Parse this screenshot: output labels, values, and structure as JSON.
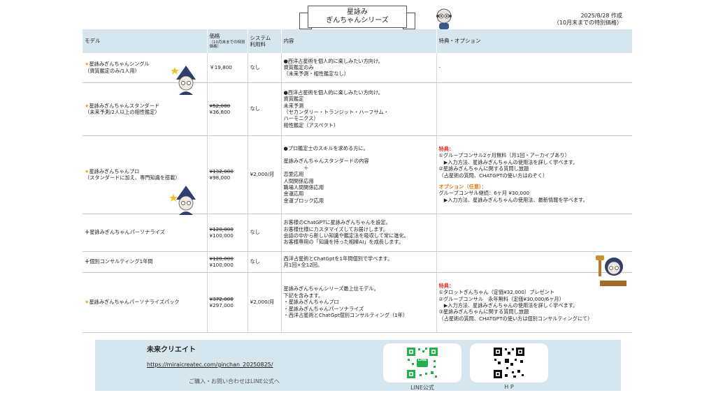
{
  "header": {
    "title_line1": "星詠み",
    "title_line2": "ぎんちゃんシリーズ",
    "date": "2025/8/28 作成",
    "date_note": "（10月末までの特別価格）"
  },
  "table": {
    "columns": {
      "model": "モデル",
      "price": "価格",
      "price_note": "（10月末までの特別価格）",
      "system_line1": "システム",
      "system_line2": "利用料",
      "content": "内容",
      "benefits": "特典・オプション"
    },
    "rows": [
      {
        "name": "星詠みぎんちゃんシングル",
        "sub": "（資質鑑定のみ/1人用）",
        "price_now": "￥19,800",
        "fee": "なし",
        "content": [
          "●西洋占星術を個人的に楽しみたい方向け。",
          "資質鑑定のみ",
          "（未来予測・相性鑑定なし）"
        ],
        "benefits": [
          "-"
        ]
      },
      {
        "name": "星詠みぎんちゃんスタンダード",
        "sub": "（未来予測/2人以上の相性鑑定）",
        "price_old": "¥52,000",
        "price_now": "¥36,800",
        "fee": "なし",
        "content": [
          "●西洋占星術を個人的に楽しみたい方向け。",
          "資質鑑定",
          "未来予測",
          "（セカンダリー・トランジット・ハーフサム・",
          "ハーモニクス）",
          "相性鑑定（アスペクト）"
        ],
        "benefits": []
      },
      {
        "name": "星詠みぎんちゃんプロ",
        "sub": "（スタンダードに加え、専門知識を搭載）",
        "price_old": "¥132,000",
        "price_now": "¥98,000",
        "fee": "¥2,000/月",
        "content": [
          "●プロ鑑定士のスキルを求める方に。",
          "",
          "星詠みぎんちゃんスタンダードの内容",
          "　　　　＋",
          "恋愛応用",
          "人間関係応用",
          "職場人間関係応用",
          "金運応用",
          "金運ブロック応用"
        ],
        "benefits_label": "特典：",
        "benefits": [
          "①グループコンサル2ヶ月無料（月1回・アーカイブあり）",
          "　▶入力方法、星詠みぎんちゃんの使用法を詳しく学べます。",
          "②星詠みぎんちゃんに関する質問し放題",
          "（占星術の質問、CHATGPTの使い方はのぞく）"
        ],
        "option_label": "オプション（任意）：",
        "options": [
          "グループコンサル継続：6ヶ月 ¥30,000",
          "　▶入力方法、星詠みぎんちゃんの使用法、最新情報を学べます。"
        ]
      },
      {
        "name": "星詠みぎんちゃんパーソナライズ",
        "price_old": "¥120,000",
        "price_now": "¥100,000",
        "fee": "なし",
        "content": [
          "お客様のChatGPTに星詠みぎんちゃんを設定。",
          "お客様仕様にカスタマイズしてお届けします。",
          "会話の中から新しい知識や鑑定法を吸収して常に進化。",
          "お客様専用の「知識を持った相棒AI」を成長します。"
        ],
        "benefits": []
      },
      {
        "name": "個別コンサルティング1年間",
        "price_old": "¥120,000",
        "price_now": "¥100,000",
        "fee": "なし",
        "content": [
          "西洋占星術とChatGptを1年間個別で学べます。",
          "月1回×全12回。"
        ],
        "benefits": []
      },
      {
        "name": "星詠みぎんちゃんパーソナライズパック",
        "price_old": "¥372,000",
        "price_now": "¥297,000",
        "fee": "¥2,000/月",
        "content": [
          "星詠みぎんちゃんシリーズ最上位モデル。",
          "下記を含みます。",
          "・星詠みぎんちゃんプロ",
          "・星詠みぎんちゃんパーソナライズ",
          "・西洋占星術とChatGpt個別コンサルティング（1年）"
        ],
        "benefits_label": "特典：",
        "benefits": [
          "①タロットぎんちゃん（定価¥32,000）プレゼント",
          "②グループコンサル　永年無料（定価¥30,000/6ヶ月）",
          "　▶入力方法、星詠みぎんちゃんの使用法を詳しく学べます。",
          "③星詠みぎんちゃんに関する質問し放題",
          "（占星術の質問、CHATGPTの使い方は個別コンサルティングにて）"
        ]
      }
    ]
  },
  "footer": {
    "company": "未来クリエイト",
    "url": "https://miraicreatec.com/ginchan_20250825/",
    "contact": "ご購入・お問い合わせはLINE公式へ",
    "qr_line_caption": "LINE公式",
    "qr_line_badge": "LINE",
    "qr_hp_caption": "H P"
  },
  "colors": {
    "header_bg": "#d6e6ee",
    "star": "#f0a020",
    "benefit_red": "#e0301e",
    "option_orange": "#e07a10",
    "line_green": "#22b14c"
  }
}
